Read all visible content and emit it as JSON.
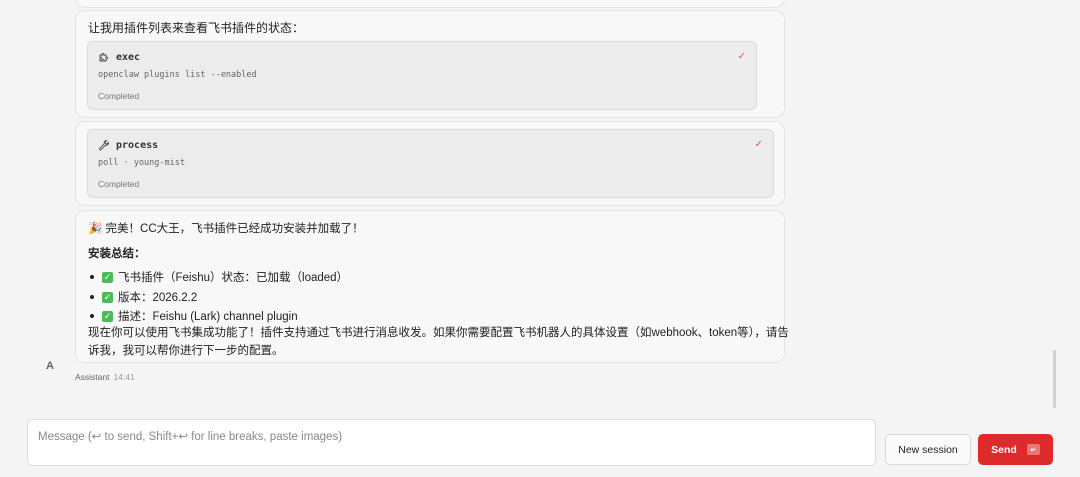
{
  "messages": {
    "exec_block": {
      "intro": "让我用插件列表来查看飞书插件的状态：",
      "tool_name": "exec",
      "command": "openclaw plugins list --enabled",
      "status": "Completed",
      "icon": "puzzle-icon"
    },
    "process_block": {
      "tool_name": "process",
      "detail": "poll · young-mist",
      "status": "Completed",
      "icon": "wrench-icon"
    },
    "final": {
      "title": "🎉 完美！CC大王，飞书插件已经成功安装并加载了！",
      "summary_heading": "安装总结：",
      "items": [
        "飞书插件（Feishu）状态：已加载（loaded）",
        "版本：2026.2.2",
        "描述：Feishu (Lark) channel plugin"
      ],
      "paragraph_line1": "现在你可以使用飞书集成功能了！插件支持通过飞书进行消息收发。如果你需要配置飞书机器人的具体设置（如webhook、token等），请告",
      "paragraph_line2": "诉我，我可以帮你进行下一步的配置。"
    },
    "avatar_letter": "A",
    "sender": "Assistant",
    "time": "14:41"
  },
  "composer": {
    "placeholder": "Message (↩ to send, Shift+↩ for line breaks, paste images)",
    "value": ""
  },
  "buttons": {
    "new_session": "New session",
    "send": "Send",
    "send_key": "↵"
  },
  "colors": {
    "accent": "#dd2b2b",
    "check_green": "#4cbb5a",
    "tool_check": "#e05a5a"
  }
}
